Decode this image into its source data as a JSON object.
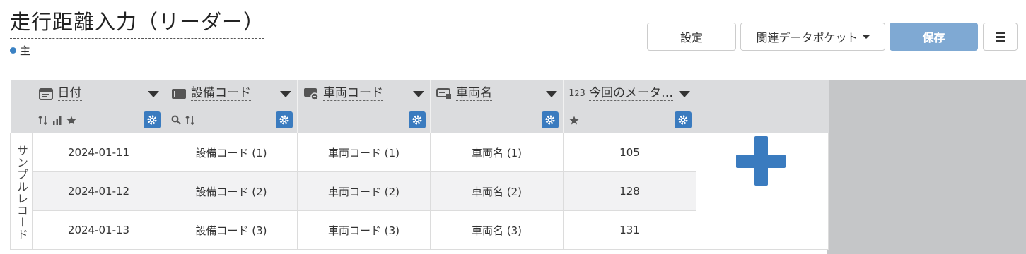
{
  "page": {
    "title": "走行距離入力（リーダー）",
    "main_tag": "主"
  },
  "toolbar": {
    "settings_label": "設定",
    "related_label": "関連データポケット",
    "save_label": "保存"
  },
  "colors": {
    "accent": "#3a7bbf",
    "save_button": "#7fa9d3",
    "header_bg": "#dbdcde"
  },
  "table": {
    "side_label": "サンプルレコード",
    "columns": [
      {
        "label": "日付",
        "icon": "calendar-icon",
        "sub_icons": [
          "sort-icon",
          "bar-chart-icon",
          "star-icon"
        ]
      },
      {
        "label": "設備コード",
        "icon": "text-field-icon",
        "sub_icons": [
          "search-icon",
          "sort-icon"
        ]
      },
      {
        "label": "車両コード",
        "icon": "vehicle-link-icon",
        "sub_icons": []
      },
      {
        "label": "車両名",
        "icon": "vehicle-icon",
        "sub_icons": []
      },
      {
        "label": "今回のメータ…",
        "icon": "number-icon",
        "icon_text": "123",
        "sub_icons": [
          "star-icon"
        ]
      }
    ],
    "rows": [
      [
        "2024-01-11",
        "設備コード (1)",
        "車両コード (1)",
        "車両名 (1)",
        "105"
      ],
      [
        "2024-01-12",
        "設備コード (2)",
        "車両コード (2)",
        "車両名 (2)",
        "128"
      ],
      [
        "2024-01-13",
        "設備コード (3)",
        "車両コード (3)",
        "車両名 (3)",
        "131"
      ]
    ]
  }
}
